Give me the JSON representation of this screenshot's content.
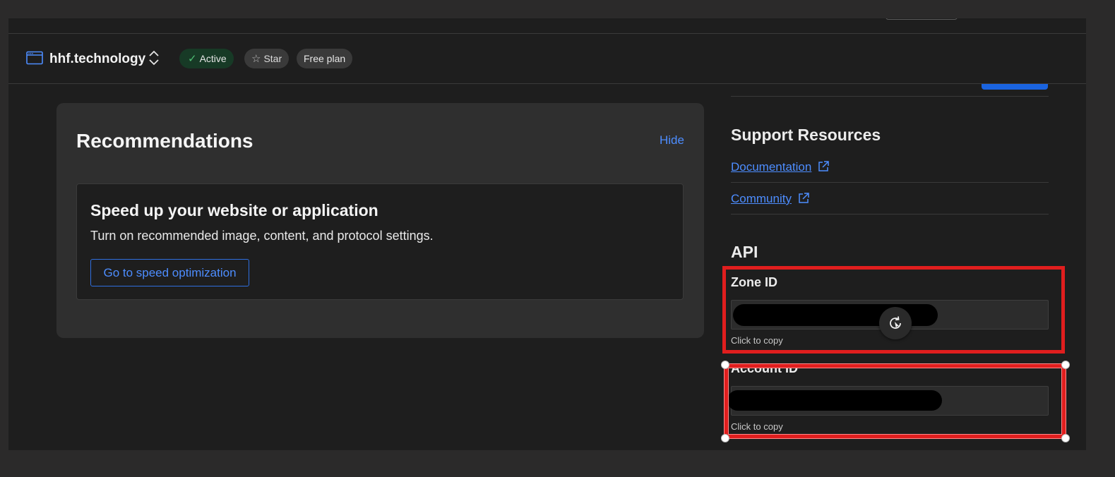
{
  "zone": {
    "name": "hhf.technology",
    "status_label": "Active",
    "star_label": "Star",
    "plan_label": "Free plan"
  },
  "recommendations": {
    "title": "Recommendations",
    "hide_label": "Hide",
    "card": {
      "title": "Speed up your website or application",
      "description": "Turn on recommended image, content, and protocol settings.",
      "button_label": "Go to speed optimization"
    }
  },
  "support": {
    "title": "Support Resources",
    "links": [
      {
        "label": "Documentation",
        "icon": "external-link-icon"
      },
      {
        "label": "Community",
        "icon": "external-link-icon"
      }
    ]
  },
  "api": {
    "title": "API",
    "zone_id": {
      "label": "Zone ID",
      "hint": "Click to copy"
    },
    "account_id": {
      "label": "Account ID",
      "hint": "Click to copy"
    }
  },
  "colors": {
    "accent": "#4d8dff",
    "status_green": "#4fbf74",
    "annotation_red": "#e01e1e"
  }
}
